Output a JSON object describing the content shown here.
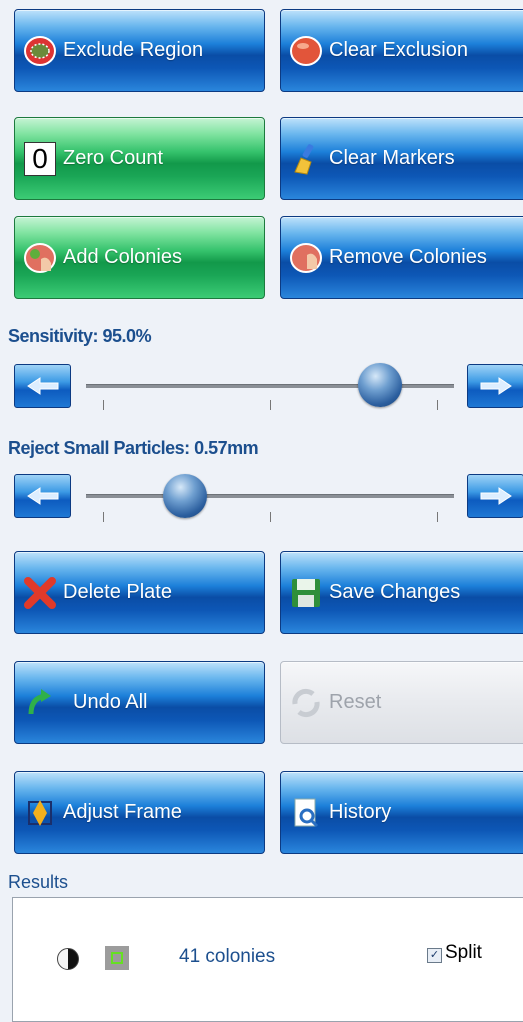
{
  "buttons": {
    "exclude_region": "Exclude Region",
    "clear_exclusion": "Clear Exclusion",
    "zero_count": "Zero Count",
    "zero_glyph": "0",
    "clear_markers": "Clear Markers",
    "add_colonies": "Add Colonies",
    "remove_colonies": "Remove Colonies",
    "delete_plate": "Delete Plate",
    "save_changes": "Save Changes",
    "undo_all": "Undo All",
    "reset": "Reset",
    "adjust_frame": "Adjust Frame",
    "history": "History"
  },
  "sensitivity": {
    "label": "Sensitivity: 95.0%",
    "value_fraction": 0.8
  },
  "reject": {
    "label": "Reject Small Particles: 0.57mm",
    "value_fraction": 0.27
  },
  "results": {
    "label": "Results",
    "count_text": "41 colonies",
    "split_label": "Split",
    "split_checked": true
  },
  "colors": {
    "accent_blue": "#0a4da6",
    "green": "#12994a",
    "label_blue": "#1c4f8e"
  }
}
